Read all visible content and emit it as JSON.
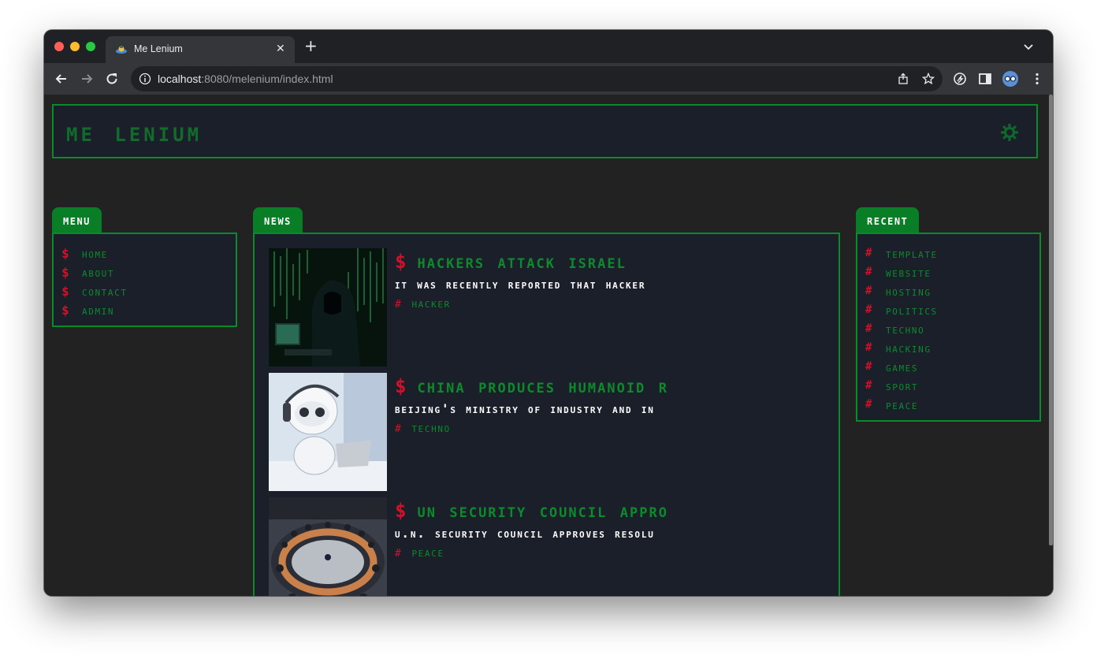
{
  "browser": {
    "tab_title": "Me Lenium",
    "url_host": "localhost",
    "url_rest": ":8080/melenium/index.html"
  },
  "site": {
    "title": "Me Lenium"
  },
  "menu": {
    "heading": "Menu",
    "symbol": "$",
    "items": [
      {
        "label": "Home"
      },
      {
        "label": "About"
      },
      {
        "label": "Contact"
      },
      {
        "label": "Admin"
      }
    ]
  },
  "news": {
    "heading": "News",
    "symbol": "$",
    "tag_symbol": "#",
    "items": [
      {
        "title": "Hackers Attack Israel",
        "summary": "It was recently reported that hacker",
        "tag": "Hacker",
        "image_icon": "hooded-hacker-image"
      },
      {
        "title": "China Produces Humanoid R",
        "summary": "Beijing's Ministry of Industry and In",
        "tag": "Techno",
        "image_icon": "robot-image"
      },
      {
        "title": "UN Security Council Appro",
        "summary": "U.N. Security Council approves resolu",
        "tag": "Peace",
        "image_icon": "council-chamber-image"
      }
    ]
  },
  "recent": {
    "heading": "Recent",
    "symbol": "#",
    "items": [
      {
        "label": "Template"
      },
      {
        "label": "Website"
      },
      {
        "label": "Hosting"
      },
      {
        "label": "Politics"
      },
      {
        "label": "Techno"
      },
      {
        "label": "Hacking"
      },
      {
        "label": "Games"
      },
      {
        "label": "Sport"
      },
      {
        "label": "Peace"
      }
    ]
  },
  "colors": {
    "accent_green": "#0a8a2a",
    "symbol_red": "#d1112a",
    "panel_bg": "#1b1f2a",
    "page_bg": "#222222"
  }
}
